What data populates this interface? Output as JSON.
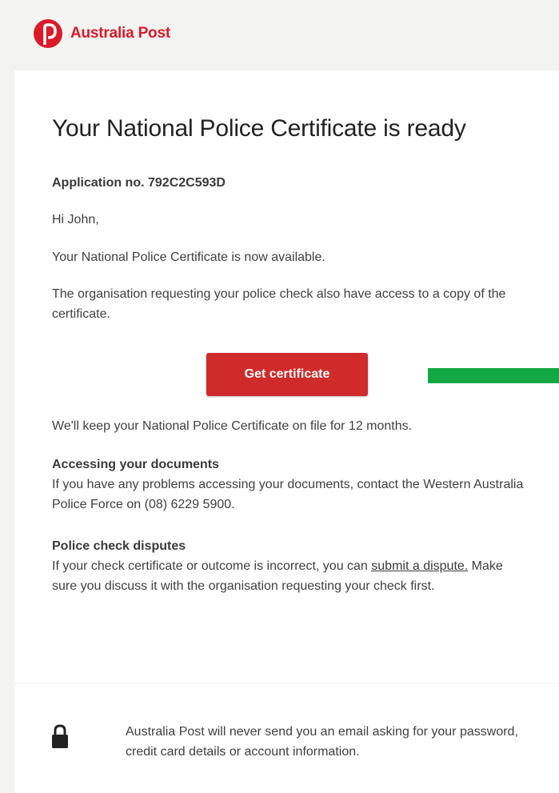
{
  "brand": {
    "name": "Australia Post",
    "color": "#dc1928"
  },
  "email": {
    "title": "Your National Police Certificate is ready",
    "application_no": "Application no. 792C2C593D",
    "greeting": "Hi John,",
    "available_text": "Your National Police Certificate is now available.",
    "org_access_text": "The organisation requesting your police check also have access to a copy of the certificate.",
    "button_label": "Get certificate",
    "button_color": "#d02b2b",
    "keep_on_file_text": "We'll keep your National Police Certificate on file for 12 months.",
    "accessing": {
      "heading": "Accessing your documents",
      "body": "If you have any problems accessing your documents, contact the Western Australia Police Force on (08) 6229 5900."
    },
    "disputes": {
      "heading": "Police check disputes",
      "body_before": "If your check certificate or outcome is incorrect, you can ",
      "link_text": "submit a dispute.",
      "body_after": " Make sure you discuss it with the organisation requesting your check first."
    },
    "footer_text": "Australia Post will never send you an email asking for your password, credit card details or account information.",
    "accent_bar_color": "#13a843"
  }
}
